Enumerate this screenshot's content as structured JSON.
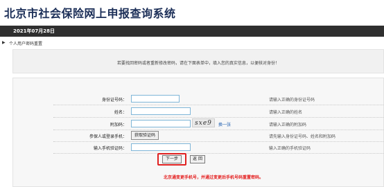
{
  "header": {
    "title": "北京市社会保险网上申报查询系统"
  },
  "datebar": {
    "date": "2021年07月28日"
  },
  "breadcrumb": {
    "arrow": "▶",
    "text": "个人用户密码重置"
  },
  "notice": {
    "text": "若要找回密码或者重新修改密码，请在下面表单中，填入您的真实信息，以便核对身份！"
  },
  "form": {
    "rows": [
      {
        "label": "身份证号码：",
        "hint": "请输入正确的身份证号码"
      },
      {
        "label": "姓名：",
        "hint": "请输入正确的姓名"
      },
      {
        "label": "附加码：",
        "hint": "请输入正确的附加码"
      },
      {
        "label": "参保人或登录手机：",
        "hint": "请先输入身份证号码、姓名和附加码"
      },
      {
        "label": "输入手机验证码：",
        "hint": "输入正确的手机验证码"
      }
    ],
    "captcha": {
      "text": "sxe9",
      "swap_label": "换一张"
    },
    "sms_button": "获取验证码"
  },
  "buttons": {
    "next": "下一步",
    "back": "返 回"
  },
  "warning": "北京通变更手机号，并通过变更后手机号码重置密码。",
  "colors": {
    "datebar": "#2f2f2f",
    "title": "#1b2e57",
    "warning": "#e41e1e",
    "highlight": "#e02020",
    "link": "#1f5fb0"
  }
}
